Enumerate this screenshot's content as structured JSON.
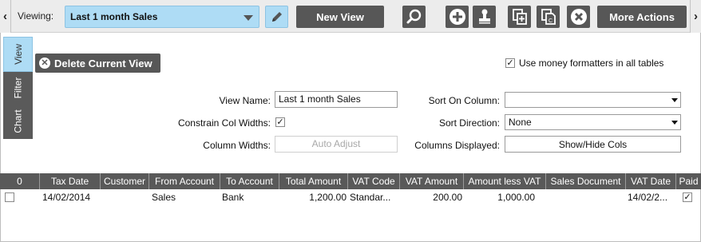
{
  "toolbar": {
    "viewing_label": "Viewing:",
    "current_view": "Last 1 month Sales",
    "new_view_label": "New View",
    "more_actions_label": "More Actions",
    "icons": [
      "edit-pencil-icon",
      "search-icon",
      "add-icon",
      "stamp-icon",
      "copy-add-icon",
      "copy-doc-icon",
      "close-icon"
    ]
  },
  "side_tabs": {
    "view": "View",
    "filter": "Filter",
    "chart": "Chart",
    "active": "View"
  },
  "view_panel": {
    "delete_label": "Delete Current View",
    "money_formatters_label": "Use money formatters in all tables",
    "money_formatters_checked": true,
    "view_name_label": "View Name:",
    "view_name_value": "Last 1 month Sales",
    "constrain_label": "Constrain Col Widths:",
    "constrain_checked": true,
    "column_widths_label": "Column Widths:",
    "auto_adjust_label": "Auto Adjust",
    "sort_column_label": "Sort On Column:",
    "sort_column_value": "",
    "sort_direction_label": "Sort Direction:",
    "sort_direction_value": "None",
    "columns_displayed_label": "Columns Displayed:",
    "show_hide_label": "Show/Hide Cols"
  },
  "grid": {
    "headers": [
      "0",
      "Tax Date",
      "Customer",
      "From Account",
      "To Account",
      "Total Amount",
      "VAT Code",
      "VAT Amount",
      "Amount less VAT",
      "Sales Document",
      "VAT Date",
      "Paid"
    ],
    "rows": [
      {
        "selected": false,
        "tax_date": "14/02/2014",
        "customer": "",
        "from_account": "Sales",
        "to_account": "Bank",
        "total_amount": "1,200.00",
        "vat_code": "Standar...",
        "vat_amount": "200.00",
        "amount_less_vat": "1,000.00",
        "sales_document": "",
        "vat_date": "14/02/2...",
        "paid": true
      }
    ]
  },
  "colors": {
    "accent_light_blue": "#aedcf5",
    "dark_button": "#575757",
    "header_bg": "#595959"
  }
}
